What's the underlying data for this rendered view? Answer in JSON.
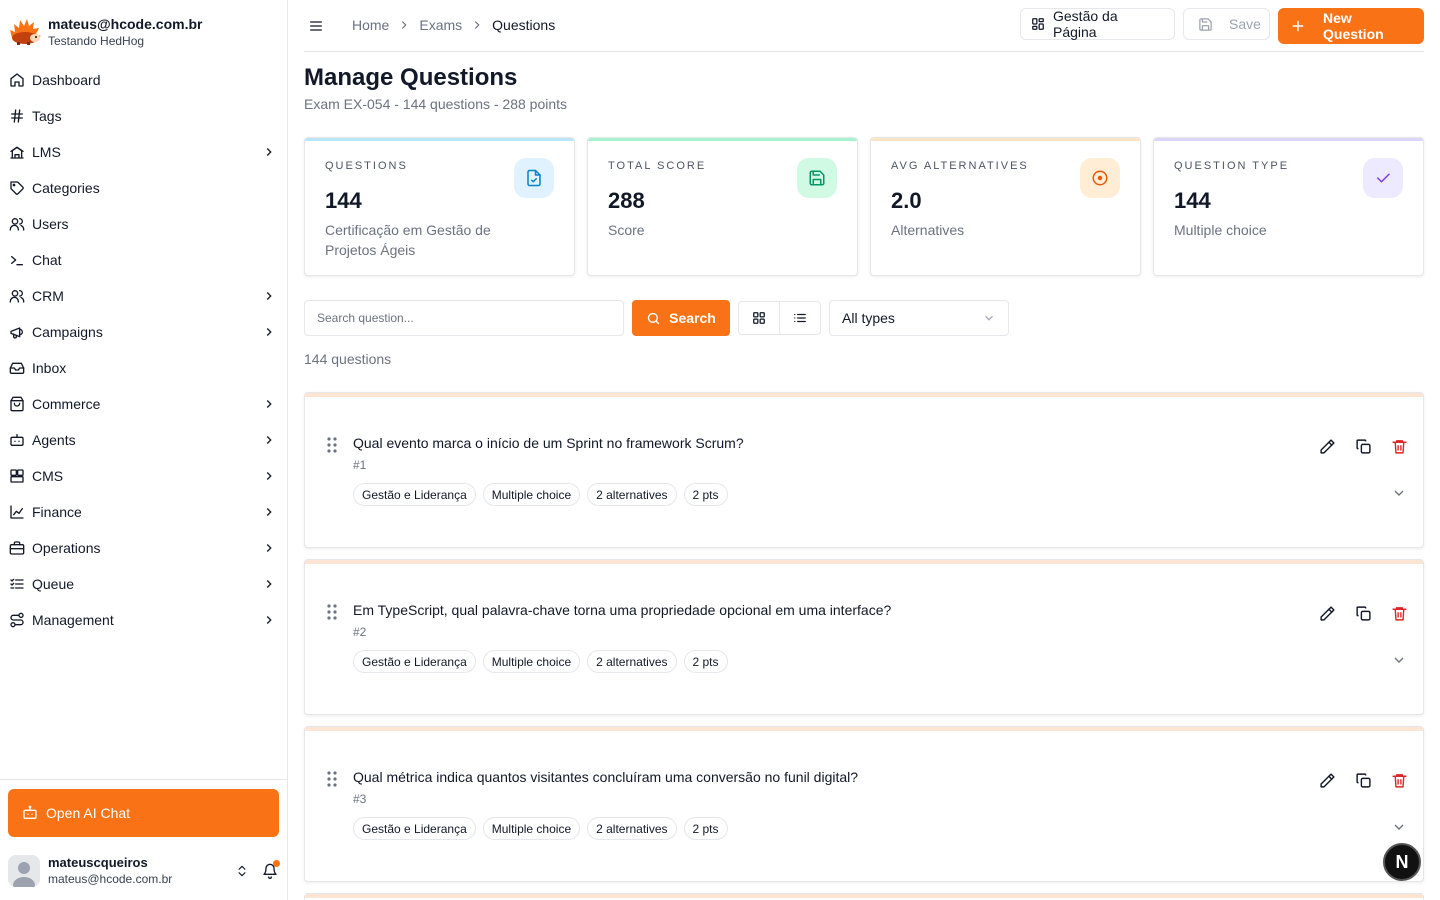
{
  "account": {
    "email": "mateus@hcode.com.br",
    "subtitle": "Testando HedHog"
  },
  "nav": [
    {
      "label": "Dashboard",
      "icon": "home-icon",
      "chevron": false
    },
    {
      "label": "Tags",
      "icon": "hash-icon",
      "chevron": false
    },
    {
      "label": "LMS",
      "icon": "school-icon",
      "chevron": true
    },
    {
      "label": "Categories",
      "icon": "tag-icon",
      "chevron": false
    },
    {
      "label": "Users",
      "icon": "users-icon",
      "chevron": false
    },
    {
      "label": "Chat",
      "icon": "terminal-icon",
      "chevron": false
    },
    {
      "label": "CRM",
      "icon": "users-icon",
      "chevron": true
    },
    {
      "label": "Campaigns",
      "icon": "megaphone-icon",
      "chevron": true
    },
    {
      "label": "Inbox",
      "icon": "inbox-icon",
      "chevron": false
    },
    {
      "label": "Commerce",
      "icon": "shopping-bag-icon",
      "chevron": true
    },
    {
      "label": "Agents",
      "icon": "bot-icon",
      "chevron": true
    },
    {
      "label": "CMS",
      "icon": "layout-icon",
      "chevron": true
    },
    {
      "label": "Finance",
      "icon": "chart-icon",
      "chevron": true
    },
    {
      "label": "Operations",
      "icon": "briefcase-icon",
      "chevron": true
    },
    {
      "label": "Queue",
      "icon": "list-icon",
      "chevron": true
    },
    {
      "label": "Management",
      "icon": "route-icon",
      "chevron": true
    }
  ],
  "footer": {
    "ai_chat_label": "Open AI Chat",
    "user_name": "mateuscqueiros",
    "user_email": "mateus@hcode.com.br"
  },
  "breadcrumb": [
    "Home",
    "Exams",
    "Questions"
  ],
  "header": {
    "page_button": "Gestão da Página",
    "save_button": "Save",
    "new_button": "New Question"
  },
  "page": {
    "title": "Manage Questions",
    "subtitle": "Exam EX-054 - 144 questions - 288 points"
  },
  "stats": [
    {
      "label": "QUESTIONS",
      "value": "144",
      "desc": "Certificação em Gestão de Projetos Ágeis",
      "accent": "#bae6fd",
      "icon_bg": "#e0f2fe",
      "icon_color": "#0284c7",
      "icon": "file-check-icon"
    },
    {
      "label": "TOTAL SCORE",
      "value": "288",
      "desc": "Score",
      "accent": "#a7f3d0",
      "icon_bg": "#d1fae5",
      "icon_color": "#059669",
      "icon": "save-icon"
    },
    {
      "label": "AVG ALTERNATIVES",
      "value": "2.0",
      "desc": "Alternatives",
      "accent": "#fde2c4",
      "icon_bg": "#ffedd5",
      "icon_color": "#ea580c",
      "icon": "target-icon"
    },
    {
      "label": "QUESTION TYPE",
      "value": "144",
      "desc": "Multiple choice",
      "accent": "#ddd6fe",
      "icon_bg": "#ede9fe",
      "icon_color": "#7c3aed",
      "icon": "check-icon"
    }
  ],
  "toolbar": {
    "search_placeholder": "Search question...",
    "search_button": "Search",
    "type_filter": "All types",
    "count": "144 questions"
  },
  "questions": [
    {
      "text": "Qual evento marca o início de um Sprint no framework Scrum?",
      "number": "#1",
      "tags": [
        "Gestão e Liderança",
        "Multiple choice",
        "2 alternatives",
        "2 pts"
      ]
    },
    {
      "text": "Em TypeScript, qual palavra-chave torna uma propriedade opcional em uma interface?",
      "number": "#2",
      "tags": [
        "Gestão e Liderança",
        "Multiple choice",
        "2 alternatives",
        "2 pts"
      ]
    },
    {
      "text": "Qual métrica indica quantos visitantes concluíram uma conversão no funil digital?",
      "number": "#3",
      "tags": [
        "Gestão e Liderança",
        "Multiple choice",
        "2 alternatives",
        "2 pts"
      ]
    }
  ],
  "colors": {
    "accent": "#f97316",
    "delete": "#dc2626"
  },
  "badge": "N"
}
